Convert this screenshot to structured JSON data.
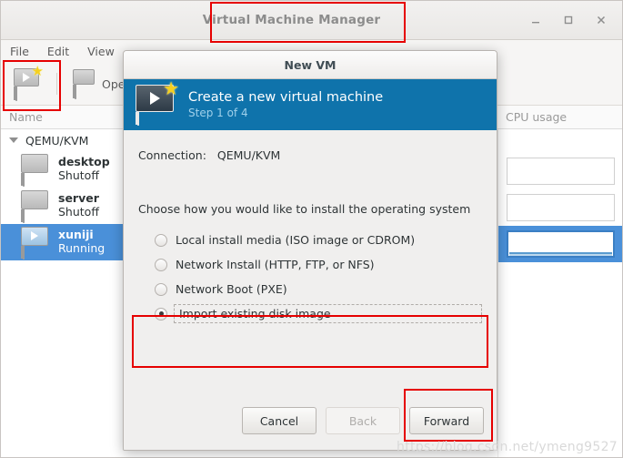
{
  "main_window": {
    "title": "Virtual Machine Manager",
    "window_controls": [
      {
        "name": "minimize",
        "glyph": "minimize-icon"
      },
      {
        "name": "maximize",
        "glyph": "maximize-icon"
      },
      {
        "name": "close",
        "glyph": "close-icon"
      }
    ],
    "menubar": [
      {
        "label": "File"
      },
      {
        "label": "Edit"
      },
      {
        "label": "View"
      }
    ],
    "toolbar": {
      "new_vm_label": "",
      "new_vm_icon": "new-vm-monitor-star-icon",
      "open_label": "Open",
      "open_icon": "monitor-icon"
    },
    "list": {
      "columns": [
        {
          "label": "Name"
        },
        {
          "label": "CPU usage"
        }
      ],
      "connection_row": {
        "label": "QEMU/KVM",
        "expanded": true
      },
      "vms": [
        {
          "name": "desktop",
          "state": "Shutoff",
          "selected": false,
          "icon": "monitor-icon"
        },
        {
          "name": "server",
          "state": "Shutoff",
          "selected": false,
          "icon": "monitor-icon"
        },
        {
          "name": "xuniji",
          "state": "Running",
          "selected": true,
          "icon": "monitor-play-icon"
        }
      ]
    }
  },
  "dialog": {
    "title": "New VM",
    "banner": {
      "heading": "Create a new virtual machine",
      "step": "Step 1 of 4",
      "icon": "new-vm-monitor-star-icon"
    },
    "connection_label": "Connection:",
    "connection_value": "QEMU/KVM",
    "prompt": "Choose how you would like to install the operating system",
    "options": [
      {
        "label": "Local install media (ISO image or CDROM)",
        "selected": false,
        "focused": false
      },
      {
        "label": "Network Install (HTTP, FTP, or NFS)",
        "selected": false,
        "focused": false
      },
      {
        "label": "Network Boot (PXE)",
        "selected": false,
        "focused": false
      },
      {
        "label": "Import existing disk image",
        "selected": true,
        "focused": true
      }
    ],
    "buttons": {
      "cancel": "Cancel",
      "back": "Back",
      "forward": "Forward"
    }
  },
  "annotations": {
    "color": "#e60000",
    "boxes": [
      "window-title",
      "new-vm-toolbar-button",
      "import-existing-disk-image-option",
      "forward-button"
    ]
  },
  "watermark": "https://blog.csdn.net/ymeng9527"
}
